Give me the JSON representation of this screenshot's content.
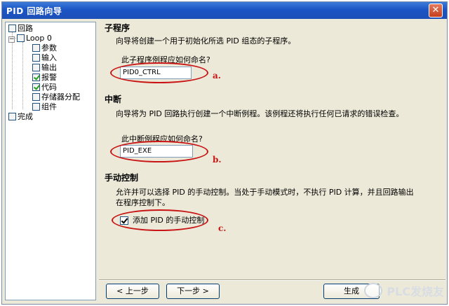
{
  "window": {
    "title": "PID 回路向导",
    "close_glyph": "✕"
  },
  "tree": {
    "items": [
      {
        "label": "回路",
        "checked": false
      },
      {
        "label": "Loop 0",
        "checked": false
      },
      {
        "label": "参数",
        "checked": false
      },
      {
        "label": "输入",
        "checked": false
      },
      {
        "label": "输出",
        "checked": false
      },
      {
        "label": "报警",
        "checked": true
      },
      {
        "label": "代码",
        "checked": true
      },
      {
        "label": "存储器分配",
        "checked": false
      },
      {
        "label": "组件",
        "checked": false
      },
      {
        "label": "完成",
        "checked": false
      }
    ],
    "expander_glyph": "−"
  },
  "subroutine": {
    "heading": "子程序",
    "description": "向导将创建一个用于初始化所选 PID 组态的子程序。",
    "prompt": "此子程序例程应如何命名?",
    "value": "PID0_CTRL",
    "marker": "a."
  },
  "interrupt": {
    "heading": "中断",
    "description": "向导将为 PID 回路执行创建一个中断例程。该例程还将执行任何已请求的错误检查。",
    "prompt": "此中断例程应如何命名?",
    "value": "PID_EXE",
    "marker": "b."
  },
  "manual": {
    "heading": "手动控制",
    "description_line1": "允许并可以选择 PID 的手动控制。当处于手动模式时，不执行 PID 计算，并且回路输出",
    "description_line2": "在程序控制下。",
    "checkbox_label": "添加 PID 的手动控制",
    "checked": true,
    "marker": "c."
  },
  "buttons": {
    "prev": "< 上一步",
    "next": "下一步 >",
    "finish": "生成"
  },
  "watermark": {
    "text": "PLC发烧友"
  },
  "colors": {
    "annotation": "#c81414",
    "titlebar": "#1b55c5"
  }
}
